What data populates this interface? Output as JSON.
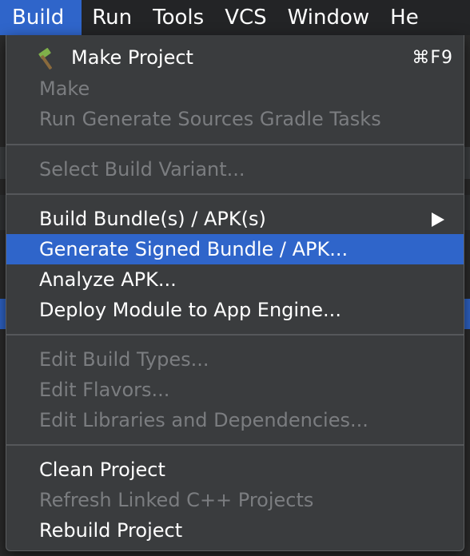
{
  "menubar": {
    "items": [
      "Build",
      "Run",
      "Tools",
      "VCS",
      "Window",
      "He"
    ]
  },
  "menu": {
    "make_project": {
      "label": "Make Project",
      "shortcut": "⌘F9",
      "icon": "hammer-icon"
    },
    "make": "Make",
    "run_generate_sources": "Run Generate Sources Gradle Tasks",
    "select_build_variant": "Select Build Variant...",
    "build_bundle": "Build Bundle(s) / APK(s)",
    "generate_signed": "Generate Signed Bundle / APK...",
    "analyze_apk": "Analyze APK...",
    "deploy_module": "Deploy Module to App Engine...",
    "edit_build_types": "Edit Build Types...",
    "edit_flavors": "Edit Flavors...",
    "edit_libraries": "Edit Libraries and Dependencies...",
    "clean_project": "Clean Project",
    "refresh_linked": "Refresh Linked C++ Projects",
    "rebuild_project": "Rebuild Project"
  },
  "colors": {
    "selection": "#2f65ca",
    "menu_bg": "#3a3c3e",
    "disabled_text": "#7b7d80"
  }
}
